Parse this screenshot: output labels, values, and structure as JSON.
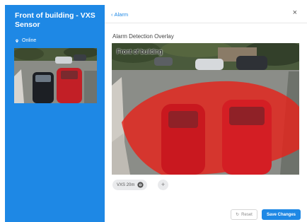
{
  "sidebar": {
    "device_title": "Front of building - VXS Sensor",
    "status": "Online",
    "status_icon": "location-pin-icon"
  },
  "panel": {
    "back_label": "Alarm",
    "close_label": "×",
    "section_title": "Alarm Detection Overlay",
    "overlay_label": "Front of building",
    "overlay_color": "#e5231b",
    "chip_label": "VXS 20m",
    "chip_icon": "camera-icon",
    "add_label": "+",
    "reset_label": "Reset",
    "save_label": "Save Changes"
  },
  "colors": {
    "sidebar": "#1e88e5",
    "accent": "#1e88e5",
    "overlay": "#e5231b"
  }
}
